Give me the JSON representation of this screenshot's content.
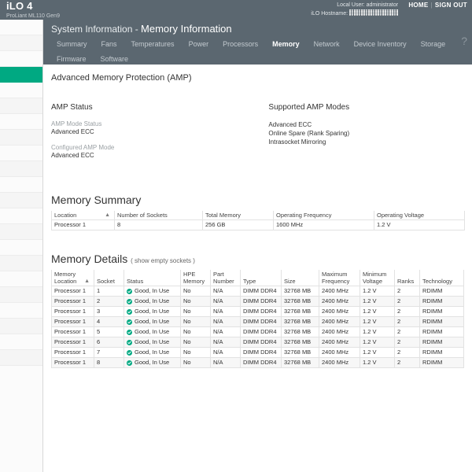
{
  "topbar": {
    "brand_title": "iLO 4",
    "brand_subtitle": "ProLiant ML110 Gen9",
    "local_user_label": "Local User:",
    "local_user_value": "administrator",
    "hostname_label": "iLO Hostname:",
    "hostname_value": "",
    "home_link": "HOME",
    "separator": "|",
    "signout_link": "SIGN OUT",
    "help_icon": "?",
    "colors": {
      "bar": "#5b6770",
      "accent": "#00a982"
    }
  },
  "panel": {
    "title_lead": "System Information - ",
    "title_strong": "Memory Information",
    "tabs": [
      {
        "label": "Summary",
        "active": false
      },
      {
        "label": "Fans",
        "active": false
      },
      {
        "label": "Temperatures",
        "active": false
      },
      {
        "label": "Power",
        "active": false
      },
      {
        "label": "Processors",
        "active": false
      },
      {
        "label": "Memory",
        "active": true
      },
      {
        "label": "Network",
        "active": false
      },
      {
        "label": "Device Inventory",
        "active": false
      },
      {
        "label": "Storage",
        "active": false
      },
      {
        "label": "Firmware",
        "active": false
      },
      {
        "label": "Software",
        "active": false
      }
    ]
  },
  "amp": {
    "heading": "Advanced Memory Protection (AMP)",
    "status_heading": "AMP Status",
    "mode_status_label": "AMP Mode Status",
    "mode_status_value": "Advanced ECC",
    "configured_label": "Configured AMP Mode",
    "configured_value": "Advanced ECC",
    "supported_heading": "Supported AMP Modes",
    "supported_modes": [
      "Advanced ECC",
      "Online Spare (Rank Sparing)",
      "Intrasocket Mirroring"
    ]
  },
  "memory_summary": {
    "heading": "Memory Summary",
    "sort_indicator": "▲",
    "columns": [
      "Location",
      "Number of Sockets",
      "Total Memory",
      "Operating Frequency",
      "Operating Voltage"
    ],
    "rows": [
      [
        "Processor 1",
        "8",
        "256 GB",
        "1600 MHz",
        "1.2 V"
      ]
    ]
  },
  "memory_details": {
    "heading": "Memory Details",
    "subtitle": "( show empty sockets )",
    "sort_indicator": "▲",
    "columns": [
      "Memory Location",
      "Socket",
      "Status",
      "HPE Memory",
      "Part Number",
      "Type",
      "Size",
      "Maximum Frequency",
      "Minimum Voltage",
      "Ranks",
      "Technology"
    ],
    "rows": [
      {
        "location": "Processor 1",
        "socket": "1",
        "status": "Good, In Use",
        "status_icon": "ok-check-icon",
        "hpe_memory": "No",
        "part_number": "N/A",
        "type": "DIMM DDR4",
        "size": "32768 MB",
        "max_frequency": "2400 MHz",
        "min_voltage": "1.2 V",
        "ranks": "2",
        "technology": "RDIMM"
      },
      {
        "location": "Processor 1",
        "socket": "2",
        "status": "Good, In Use",
        "status_icon": "ok-check-icon",
        "hpe_memory": "No",
        "part_number": "N/A",
        "type": "DIMM DDR4",
        "size": "32768 MB",
        "max_frequency": "2400 MHz",
        "min_voltage": "1.2 V",
        "ranks": "2",
        "technology": "RDIMM"
      },
      {
        "location": "Processor 1",
        "socket": "3",
        "status": "Good, In Use",
        "status_icon": "ok-check-icon",
        "hpe_memory": "No",
        "part_number": "N/A",
        "type": "DIMM DDR4",
        "size": "32768 MB",
        "max_frequency": "2400 MHz",
        "min_voltage": "1.2 V",
        "ranks": "2",
        "technology": "RDIMM"
      },
      {
        "location": "Processor 1",
        "socket": "4",
        "status": "Good, In Use",
        "status_icon": "ok-check-icon",
        "hpe_memory": "No",
        "part_number": "N/A",
        "type": "DIMM DDR4",
        "size": "32768 MB",
        "max_frequency": "2400 MHz",
        "min_voltage": "1.2 V",
        "ranks": "2",
        "technology": "RDIMM"
      },
      {
        "location": "Processor 1",
        "socket": "5",
        "status": "Good, In Use",
        "status_icon": "ok-check-icon",
        "hpe_memory": "No",
        "part_number": "N/A",
        "type": "DIMM DDR4",
        "size": "32768 MB",
        "max_frequency": "2400 MHz",
        "min_voltage": "1.2 V",
        "ranks": "2",
        "technology": "RDIMM"
      },
      {
        "location": "Processor 1",
        "socket": "6",
        "status": "Good, In Use",
        "status_icon": "ok-check-icon",
        "hpe_memory": "No",
        "part_number": "N/A",
        "type": "DIMM DDR4",
        "size": "32768 MB",
        "max_frequency": "2400 MHz",
        "min_voltage": "1.2 V",
        "ranks": "2",
        "technology": "RDIMM"
      },
      {
        "location": "Processor 1",
        "socket": "7",
        "status": "Good, In Use",
        "status_icon": "ok-check-icon",
        "hpe_memory": "No",
        "part_number": "N/A",
        "type": "DIMM DDR4",
        "size": "32768 MB",
        "max_frequency": "2400 MHz",
        "min_voltage": "1.2 V",
        "ranks": "2",
        "technology": "RDIMM"
      },
      {
        "location": "Processor 1",
        "socket": "8",
        "status": "Good, In Use",
        "status_icon": "ok-check-icon",
        "hpe_memory": "No",
        "part_number": "N/A",
        "type": "DIMM DDR4",
        "size": "32768 MB",
        "max_frequency": "2400 MHz",
        "min_voltage": "1.2 V",
        "ranks": "2",
        "technology": "RDIMM"
      }
    ]
  },
  "sidebar": {
    "active_index": 3,
    "row_count": 22
  }
}
